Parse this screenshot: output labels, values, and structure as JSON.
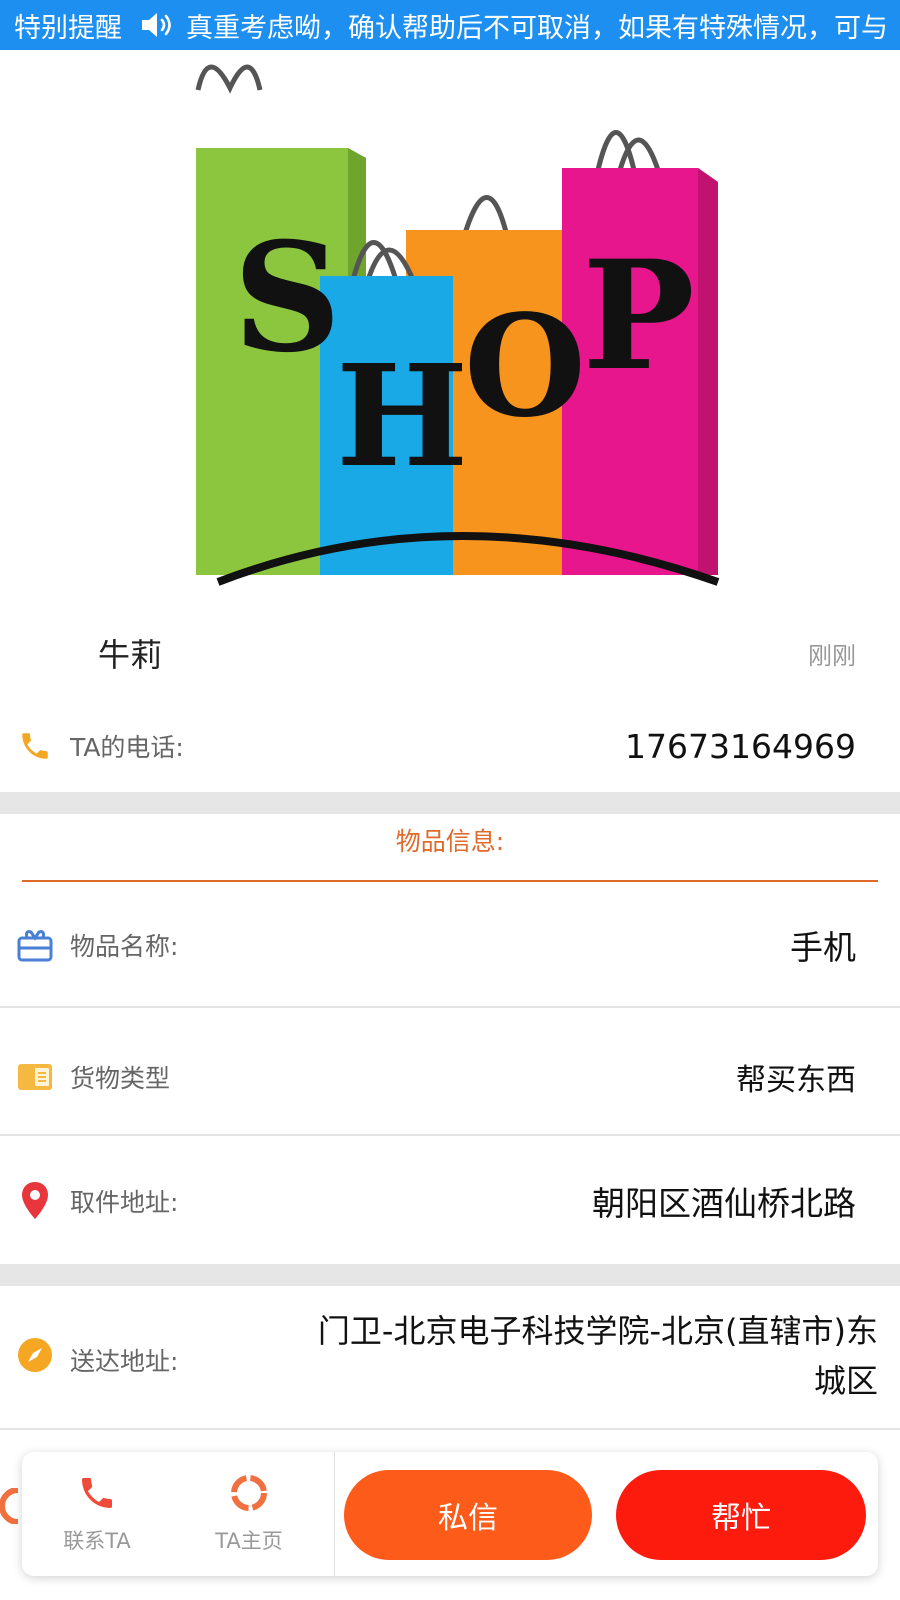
{
  "notice": {
    "title": "特别提醒",
    "text": "真重考虑呦，确认帮助后不可取消，如果有特殊情况，可与"
  },
  "publisher": {
    "name": "牛莉",
    "time": "刚刚"
  },
  "phone": {
    "label": "TA的电话:",
    "value": "17673164969"
  },
  "section": {
    "title": "物品信息:"
  },
  "items": [
    {
      "label": "物品名称:",
      "value": "手机"
    },
    {
      "label": "货物类型",
      "value": "帮买东西"
    },
    {
      "label": "取件地址:",
      "value": "朝阳区酒仙桥北路"
    },
    {
      "label": "送达地址:",
      "value": "门卫-北京电子科技学院-北京(直辖市)东城区"
    }
  ],
  "toolbar": {
    "contact_label": "联系TA",
    "home_label": "TA主页",
    "message_label": "私信",
    "help_label": "帮忙"
  },
  "colors": {
    "notice_bg": "#1c8ff0",
    "accent_orange": "#e06a2c",
    "message_btn": "#fd5b19",
    "help_btn": "#fd1b0e",
    "phone_icon": "#f5a623",
    "gift_icon": "#4a7fd6",
    "pin_icon": "#e8373c",
    "compass_icon": "#f5a623"
  },
  "icons": {
    "notice": "speaker-icon",
    "phone": "phone-icon",
    "item_name": "gift-icon",
    "item_type": "card-icon",
    "pickup": "location-pin-icon",
    "delivery": "compass-icon",
    "contact": "phone-icon",
    "home": "ring-icon"
  }
}
